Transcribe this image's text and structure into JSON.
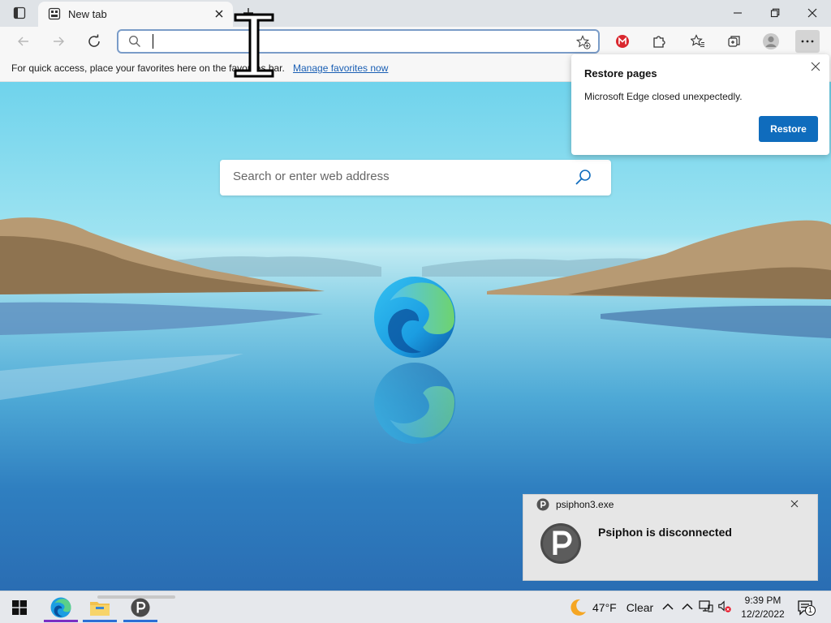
{
  "browser": {
    "tab": {
      "title": "New tab"
    },
    "address": {
      "value": "",
      "placeholder": ""
    },
    "favorites_bar": {
      "text": "For quick access, place your favorites here on the favorites bar.",
      "link": "Manage favorites now"
    }
  },
  "page": {
    "search": {
      "placeholder": "Search or enter web address"
    }
  },
  "restore_popup": {
    "title": "Restore pages",
    "message": "Microsoft Edge closed unexpectedly.",
    "button": "Restore"
  },
  "toast": {
    "app": "psiphon3.exe",
    "message": "Psiphon is disconnected"
  },
  "taskbar": {
    "weather": {
      "temp": "47°F",
      "condition": "Clear"
    },
    "clock": {
      "time": "9:39 PM",
      "date": "12/2/2022"
    },
    "notification_count": "1"
  },
  "colors": {
    "accent": "#0f6cbd",
    "edge_active": "#7a2fc4",
    "explorer_active": "#2b6fd6",
    "psiphon_active": "#2b6fd6"
  }
}
